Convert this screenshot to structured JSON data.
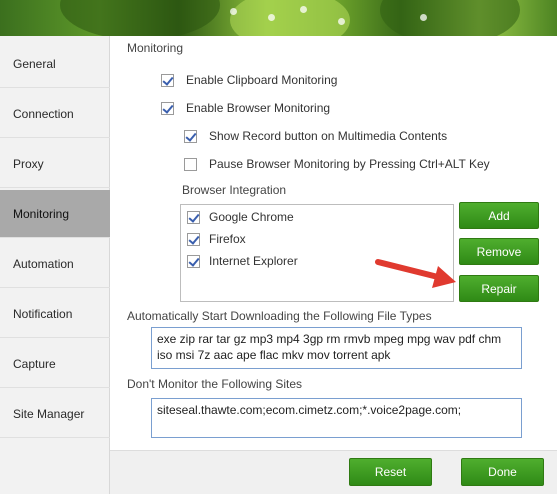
{
  "sidebar": {
    "items": [
      {
        "label": "General",
        "active": false
      },
      {
        "label": "Connection",
        "active": false
      },
      {
        "label": "Proxy",
        "active": false
      },
      {
        "label": "Monitoring",
        "active": true
      },
      {
        "label": "Automation",
        "active": false
      },
      {
        "label": "Notification",
        "active": false
      },
      {
        "label": "Capture",
        "active": false
      },
      {
        "label": "Site Manager",
        "active": false
      }
    ]
  },
  "monitoring": {
    "title": "Monitoring",
    "clipboard_label": "Enable Clipboard Monitoring",
    "clipboard_checked": true,
    "browser_label": "Enable Browser Monitoring",
    "browser_checked": true,
    "show_record_label": "Show Record button on Multimedia Contents",
    "show_record_checked": true,
    "pause_label": "Pause Browser Monitoring by Pressing Ctrl+ALT Key",
    "pause_checked": false
  },
  "browser_integration": {
    "title": "Browser Integration",
    "browsers": [
      {
        "label": "Google Chrome",
        "checked": true
      },
      {
        "label": "Firefox",
        "checked": true
      },
      {
        "label": "Internet Explorer",
        "checked": true
      }
    ],
    "add_label": "Add",
    "remove_label": "Remove",
    "repair_label": "Repair"
  },
  "file_types": {
    "title": "Automatically Start Downloading the Following File Types",
    "value": "exe zip rar tar gz mp3 mp4 3gp rm rmvb mpeg mpg wav pdf chm iso msi 7z aac ape flac mkv mov torrent apk"
  },
  "sites": {
    "title": "Don't Monitor the Following Sites",
    "value": "siteseal.thawte.com;ecom.cimetz.com;*.voice2page.com;"
  },
  "footer": {
    "reset_label": "Reset",
    "done_label": "Done"
  },
  "colors": {
    "accent_green": "#3a9a1c",
    "arrow_red": "#e03a2f",
    "active_nav": "#a9a9a9"
  }
}
